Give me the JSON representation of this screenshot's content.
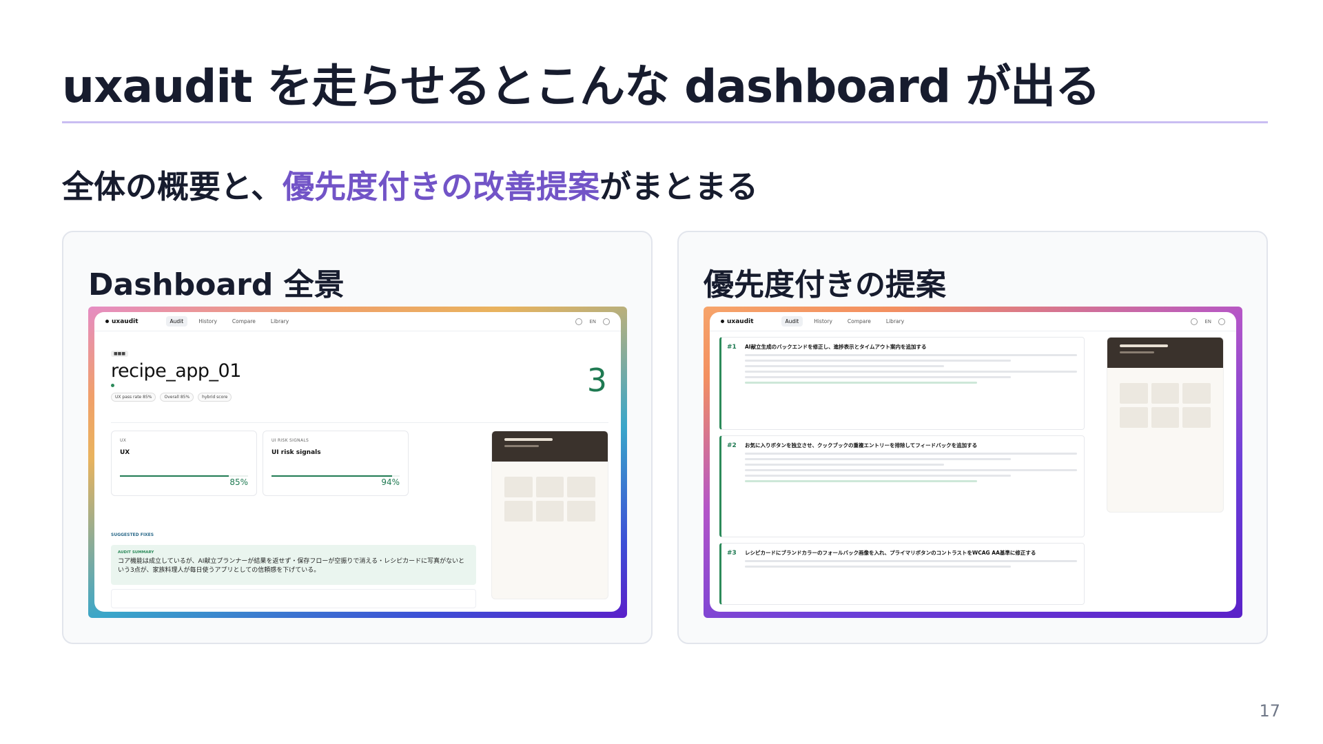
{
  "slide": {
    "title": "uxaudit を走らせるとこんな dashboard が出る",
    "subtitle_pre": "全体の概要と、",
    "subtitle_highlight": "優先度付きの改善提案",
    "subtitle_post": "がまとまる",
    "page_number": "17"
  },
  "left_card": {
    "title": "Dashboard 全景"
  },
  "right_card": {
    "title": "優先度付きの提案"
  },
  "app": {
    "brand": "uxaudit",
    "tabs": [
      "Audit",
      "History",
      "Compare",
      "Library"
    ],
    "lang": "EN"
  },
  "dashboard": {
    "app_name": "recipe_app_01",
    "chips": [
      "UX pass rate 85%",
      "Overall 85%",
      "hybrid score"
    ],
    "score": "3",
    "ux_panel": {
      "head": "UX",
      "title": "UX",
      "pct": "85%",
      "fill": 0.85
    },
    "risk_panel": {
      "head": "UI RISK SIGNALS",
      "title": "UI risk signals",
      "pct": "94%",
      "fill": 0.94
    },
    "suggested_label": "SUGGESTED FIXES",
    "summary_label": "AUDIT SUMMARY",
    "summary_text": "コア機能は成立しているが、AI献立プランナーが結果を返せず・保存フローが空振りで消える・レシピカードに写真がないという3点が、家族料理人が毎日使うアプリとしての信頼感を下げている。"
  },
  "proposals": [
    {
      "rank": "#1",
      "title": "AI献立生成のバックエンドを修正し、進捗表示とタイムアウト案内を追加する"
    },
    {
      "rank": "#2",
      "title": "お気に入りボタンを独立させ、クックブックの重複エントリーを排除してフィードバックを追加する"
    },
    {
      "rank": "#3",
      "title": "レシピカードにブランドカラーのフォールバック画像を入れ、プライマリボタンのコントラストをWCAG AA基準に修正する"
    }
  ],
  "colors": {
    "accent": "#7254c7",
    "score_green": "#1f7a52",
    "rule": "#c9bdf2"
  }
}
